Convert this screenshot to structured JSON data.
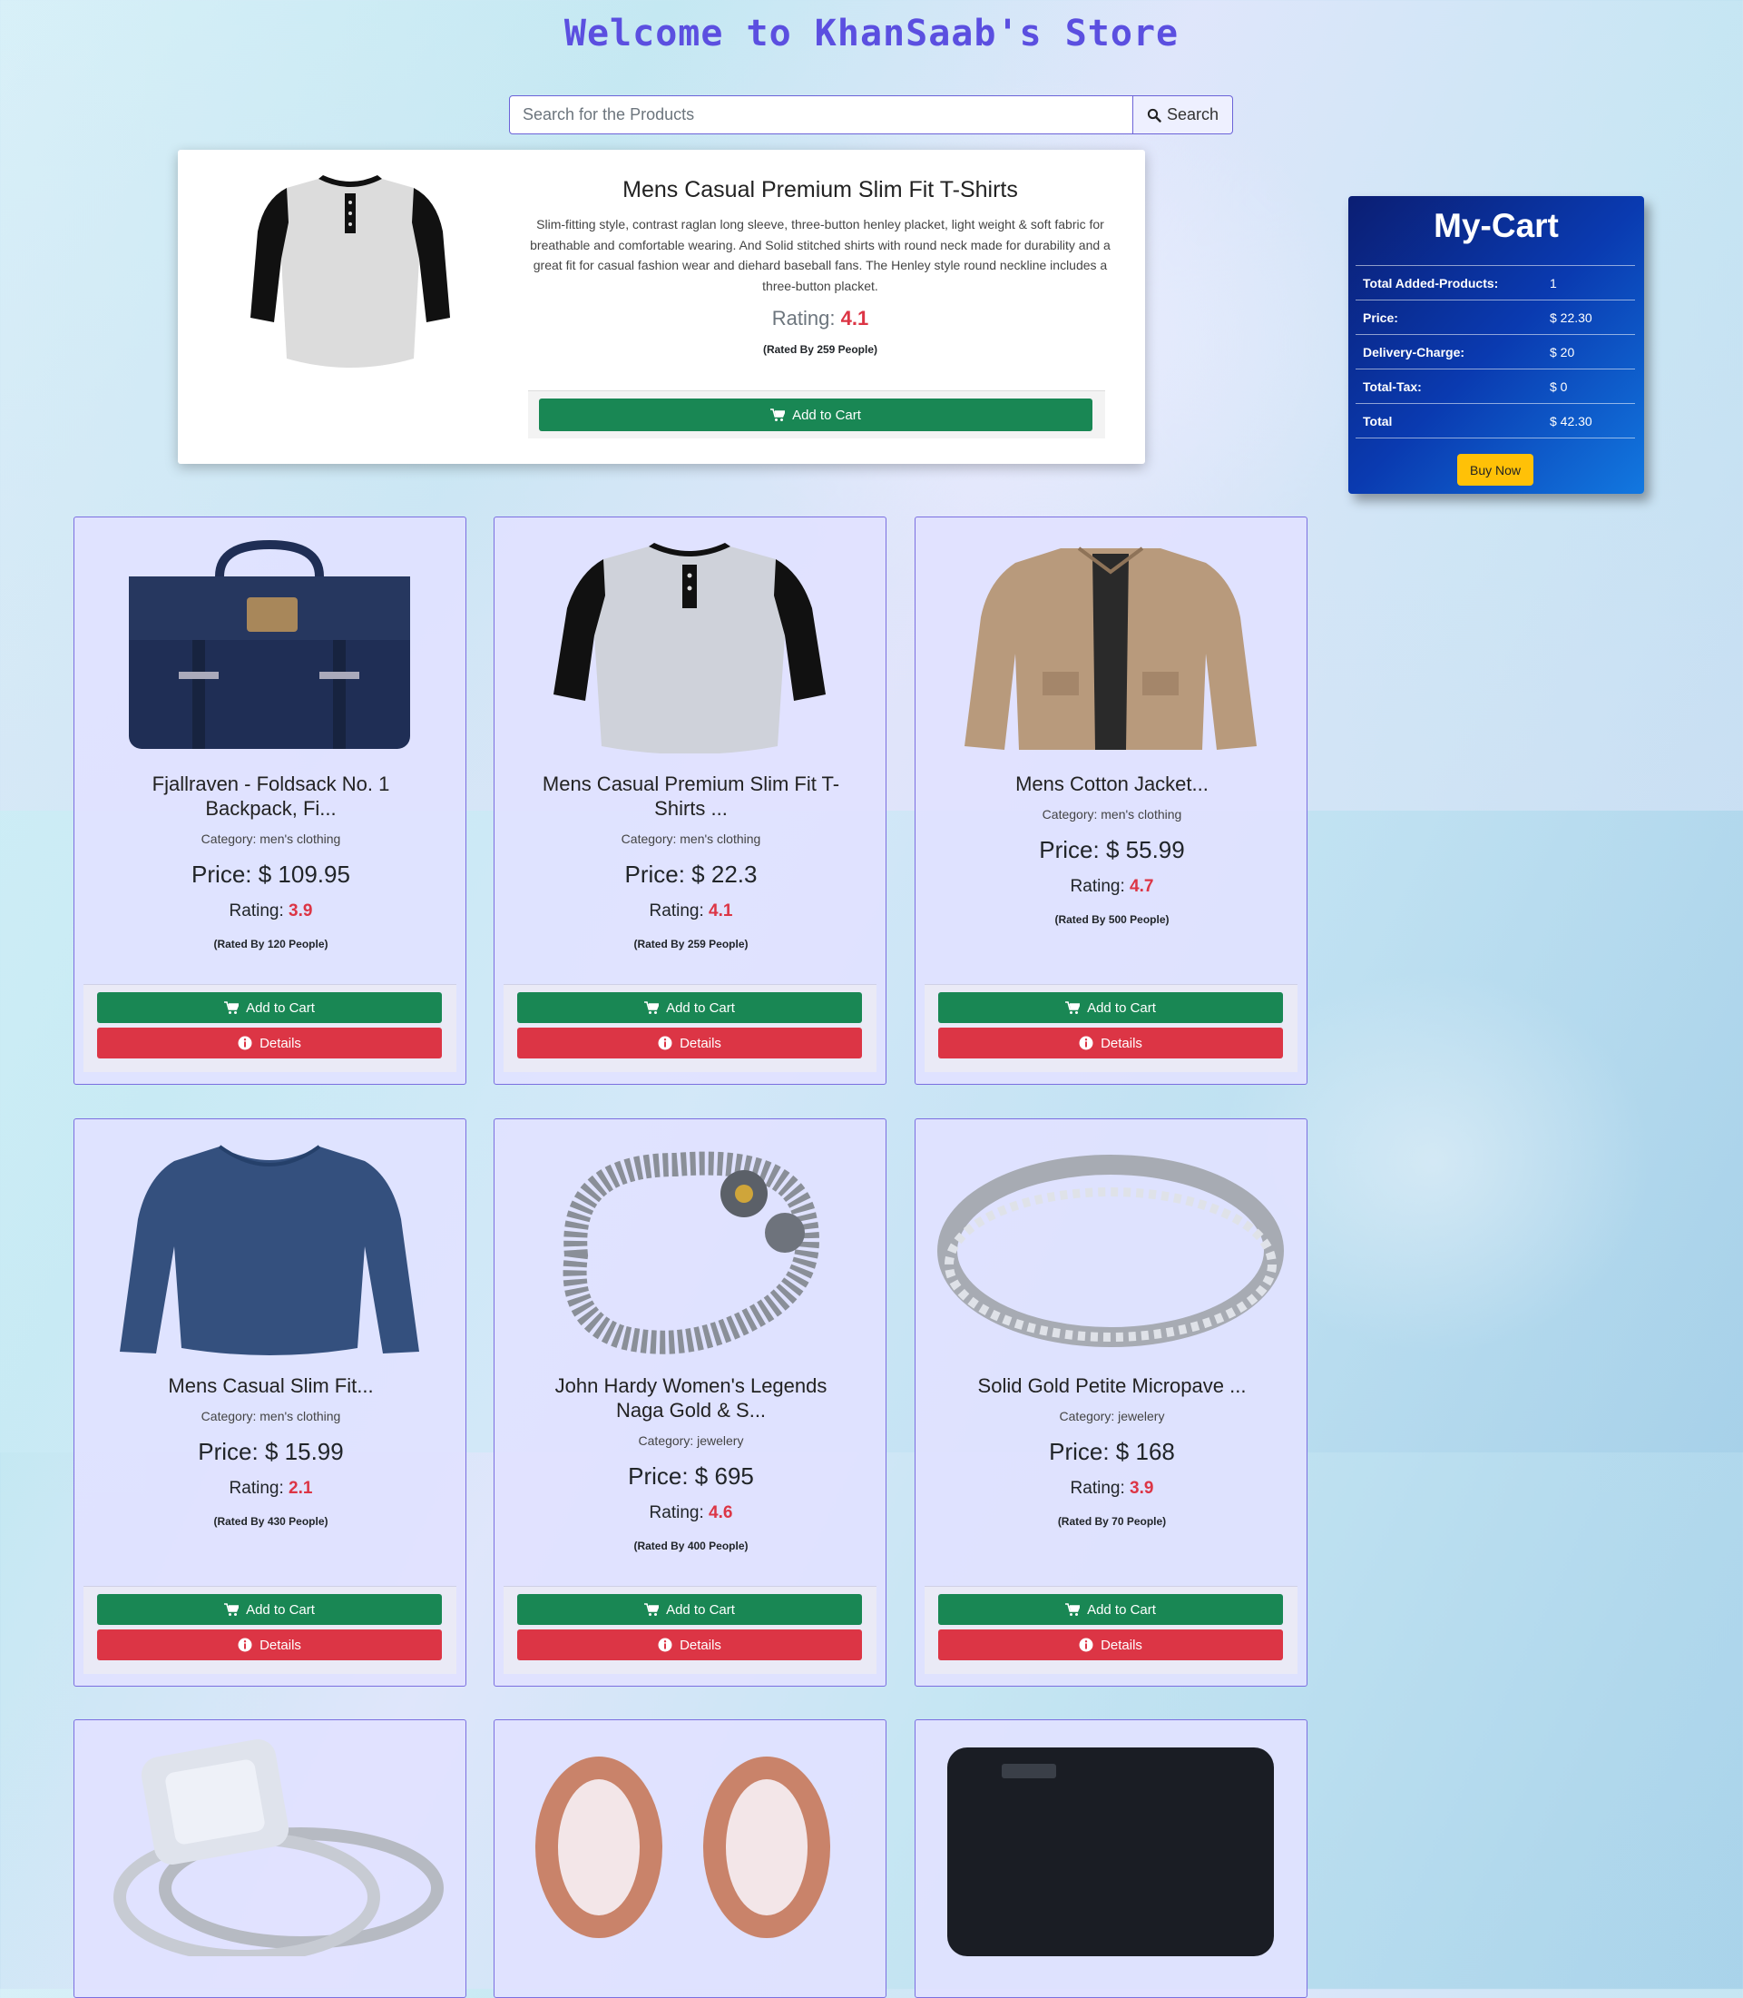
{
  "header": {
    "title": "Welcome to KhanSaab's Store"
  },
  "search": {
    "placeholder": "Search for the Products",
    "button_label": "Search"
  },
  "featured": {
    "title": "Mens Casual Premium Slim Fit T-Shirts",
    "description": "Slim-fitting style, contrast raglan long sleeve, three-button henley placket, light weight & soft fabric for breathable and comfortable wearing. And Solid stitched shirts with round neck made for durability and a great fit for casual fashion wear and diehard baseball fans. The Henley style round neckline includes a three-button placket.",
    "rating_label": "Rating:",
    "rating": "4.1",
    "rated_by": "(Rated By 259 People)",
    "add_to_cart": "Add to Cart",
    "image_icon": "raglan-tshirt-image"
  },
  "cart": {
    "title": "My-Cart",
    "rows": [
      {
        "label": "Total Added-Products:",
        "value": "1"
      },
      {
        "label": "Price:",
        "value": "$ 22.30"
      },
      {
        "label": "Delivery-Charge:",
        "value": "$ 20"
      },
      {
        "label": "Total-Tax:",
        "value": "$ 0"
      },
      {
        "label": "Total",
        "value": "$ 42.30"
      }
    ],
    "buy_now": "Buy Now"
  },
  "products": [
    {
      "title_l1": "Fjallraven - Foldsack No. 1",
      "title_l2": "Backpack, Fi...",
      "category": "Category: men's clothing",
      "price": "Price: $ 109.95",
      "rating": "3.9",
      "rated_by": "(Rated By 120 People)",
      "image_icon": "backpack-image"
    },
    {
      "title_l1": "Mens Casual Premium Slim Fit T-",
      "title_l2": "Shirts ...",
      "category": "Category: men's clothing",
      "price": "Price: $ 22.3",
      "rating": "4.1",
      "rated_by": "(Rated By 259 People)",
      "image_icon": "raglan-tshirt-image"
    },
    {
      "title_l1": "Mens Cotton Jacket...",
      "title_l2": "",
      "category": "Category: men's clothing",
      "price": "Price: $ 55.99",
      "rating": "4.7",
      "rated_by": "(Rated By 500 People)",
      "image_icon": "jacket-image"
    },
    {
      "title_l1": "Mens Casual Slim Fit...",
      "title_l2": "",
      "category": "Category: men's clothing",
      "price": "Price: $ 15.99",
      "rating": "2.1",
      "rated_by": "(Rated By 430 People)",
      "image_icon": "longsleeve-shirt-image"
    },
    {
      "title_l1": "John Hardy Women's Legends",
      "title_l2": "Naga Gold & S...",
      "category": "Category: jewelery",
      "price": "Price: $ 695",
      "rating": "4.6",
      "rated_by": "(Rated By 400 People)",
      "image_icon": "chain-bracelet-image"
    },
    {
      "title_l1": "Solid Gold Petite Micropave ...",
      "title_l2": "",
      "category": "Category: jewelery",
      "price": "Price: $ 168",
      "rating": "3.9",
      "rated_by": "(Rated By 70 People)",
      "image_icon": "silver-ring-image"
    },
    {
      "image_icon": "diamond-ring-image"
    },
    {
      "image_icon": "rose-gold-plugs-image"
    },
    {
      "image_icon": "external-hard-drive-image"
    }
  ],
  "labels": {
    "rating_label": "Rating:",
    "add_to_cart": "Add to Cart",
    "details": "Details"
  },
  "colors": {
    "accent": "#5b4fe0",
    "success": "#198754",
    "danger": "#dc3545",
    "warning": "#ffc107",
    "cart_bg": "#0a3ab0"
  }
}
